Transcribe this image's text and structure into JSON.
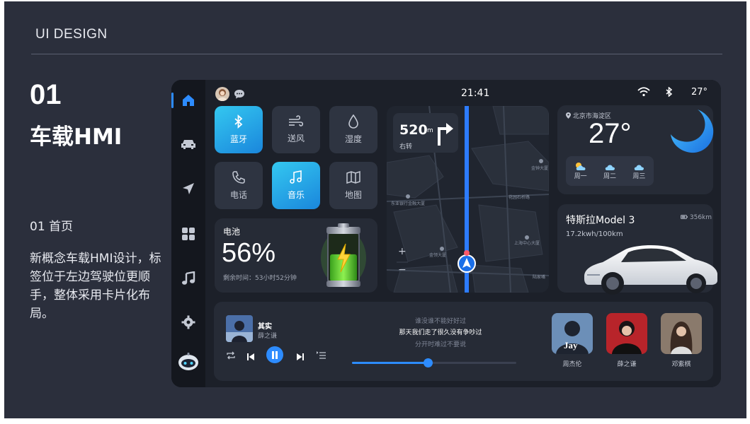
{
  "slide": {
    "header": "UI DESIGN",
    "number": "01",
    "title": "车载HMI",
    "subtitle": "01  首页",
    "description": "新概念车载HMI设计，标签位于左边驾驶位更顺手，整体采用卡片化布局。"
  },
  "sidebar": {
    "icons": [
      "home-icon",
      "car-icon",
      "navigation-icon",
      "apps-icon",
      "music-icon",
      "settings-icon",
      "assistant-icon"
    ],
    "active": "home-icon"
  },
  "status": {
    "time": "21:41",
    "temperature": "27°"
  },
  "quick_controls": [
    {
      "label": "蓝牙",
      "icon": "bluetooth-icon",
      "active": true
    },
    {
      "label": "送风",
      "icon": "wind-icon",
      "active": false
    },
    {
      "label": "湿度",
      "icon": "droplet-icon",
      "active": false
    },
    {
      "label": "电话",
      "icon": "phone-icon",
      "active": false
    },
    {
      "label": "音乐",
      "icon": "music-note-icon",
      "active": true
    },
    {
      "label": "地图",
      "icon": "map-icon",
      "active": false
    }
  ],
  "battery": {
    "title": "电池",
    "percent": "56%",
    "level": 0.56,
    "remaining": "剩余时间：53小时52分钟"
  },
  "navigation": {
    "distance": "520",
    "unit": "m",
    "instruction": "右转",
    "zoom_in": "+",
    "zoom_out": "−",
    "places": [
      "东亚银行金融大厦",
      "金领大厦",
      "花园石桥路",
      "金钟大厦",
      "上海中心大厦",
      "陆家嘴"
    ]
  },
  "weather": {
    "location": "北京市海淀区",
    "temperature": "27°",
    "forecast": [
      "周一",
      "周二",
      "周三"
    ]
  },
  "car": {
    "model": "特斯拉Model 3",
    "range": "356km",
    "efficiency": "17.2kwh/100km"
  },
  "music": {
    "song": "其实",
    "singer": "薛之谦",
    "lyrics": [
      "谁没谁不能好好过",
      "那天我们走了很久没有争吵过",
      "分开时难过不要说"
    ],
    "progress": 0.46,
    "artists": [
      {
        "name": "周杰伦",
        "tag": "Jay"
      },
      {
        "name": "薛之谦",
        "tag": ""
      },
      {
        "name": "邓紫棋",
        "tag": ""
      }
    ]
  },
  "colors": {
    "accent": "#2d8cff",
    "tile_gradient_start": "#34c8f0",
    "battery_green": "#6bd23a",
    "card": "#262b36"
  }
}
